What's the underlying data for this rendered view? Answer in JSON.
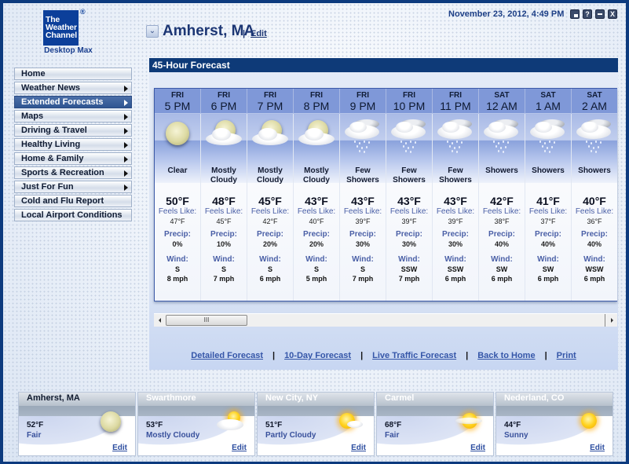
{
  "app": {
    "logo_lines": [
      "The",
      "Weather",
      "Channel"
    ],
    "logo_registered": "®",
    "logo_subtitle": "Desktop Max",
    "datetime": "November 23, 2012, 4:49 PM",
    "window_buttons": [
      {
        "name": "restore",
        "label": ""
      },
      {
        "name": "help",
        "label": "?"
      },
      {
        "name": "minimize",
        "label": ""
      },
      {
        "name": "close",
        "label": "X"
      }
    ]
  },
  "location": {
    "name": "Amherst, MA",
    "separator": "|",
    "edit_label": "Edit"
  },
  "sidebar": {
    "items": [
      {
        "label": "Home",
        "has_submenu": false,
        "active": false
      },
      {
        "label": "Weather News",
        "has_submenu": true,
        "active": false
      },
      {
        "label": "Extended Forecasts",
        "has_submenu": true,
        "active": true
      },
      {
        "label": "Maps",
        "has_submenu": true,
        "active": false
      },
      {
        "label": "Driving & Travel",
        "has_submenu": true,
        "active": false
      },
      {
        "label": "Healthy Living",
        "has_submenu": true,
        "active": false
      },
      {
        "label": "Home & Family",
        "has_submenu": true,
        "active": false
      },
      {
        "label": "Sports & Recreation",
        "has_submenu": true,
        "active": false
      },
      {
        "label": "Just For Fun",
        "has_submenu": true,
        "active": false
      },
      {
        "label": "Cold and Flu Report",
        "has_submenu": false,
        "active": false
      },
      {
        "label": "Local Airport Conditions",
        "has_submenu": false,
        "active": false
      }
    ]
  },
  "forecast": {
    "title": "45-Hour Forecast",
    "feels_like_label": "Feels Like:",
    "precip_label": "Precip:",
    "wind_label": "Wind:",
    "hours": [
      {
        "day": "FRI",
        "time": "5 PM",
        "icon": "moon-clear-icon",
        "condition": "Clear",
        "temp": "50°F",
        "feels_like": "47°F",
        "precip": "0%",
        "wind_dir": "S",
        "wind_speed": "8 mph"
      },
      {
        "day": "FRI",
        "time": "6 PM",
        "icon": "moon-cloudy-icon",
        "condition": "Mostly Cloudy",
        "temp": "48°F",
        "feels_like": "45°F",
        "precip": "10%",
        "wind_dir": "S",
        "wind_speed": "7 mph"
      },
      {
        "day": "FRI",
        "time": "7 PM",
        "icon": "moon-cloudy-icon",
        "condition": "Mostly Cloudy",
        "temp": "45°F",
        "feels_like": "42°F",
        "precip": "20%",
        "wind_dir": "S",
        "wind_speed": "6 mph"
      },
      {
        "day": "FRI",
        "time": "8 PM",
        "icon": "moon-cloudy-icon",
        "condition": "Mostly Cloudy",
        "temp": "43°F",
        "feels_like": "40°F",
        "precip": "20%",
        "wind_dir": "S",
        "wind_speed": "5 mph"
      },
      {
        "day": "FRI",
        "time": "9 PM",
        "icon": "rain-cloud-icon",
        "condition": "Few Showers",
        "temp": "43°F",
        "feels_like": "39°F",
        "precip": "30%",
        "wind_dir": "S",
        "wind_speed": "7 mph"
      },
      {
        "day": "FRI",
        "time": "10 PM",
        "icon": "rain-cloud-icon",
        "condition": "Few Showers",
        "temp": "43°F",
        "feels_like": "39°F",
        "precip": "30%",
        "wind_dir": "SSW",
        "wind_speed": "7 mph"
      },
      {
        "day": "FRI",
        "time": "11 PM",
        "icon": "rain-cloud-icon",
        "condition": "Few Showers",
        "temp": "43°F",
        "feels_like": "39°F",
        "precip": "30%",
        "wind_dir": "SSW",
        "wind_speed": "6 mph"
      },
      {
        "day": "SAT",
        "time": "12 AM",
        "icon": "rain-cloud-icon",
        "condition": "Showers",
        "temp": "42°F",
        "feels_like": "38°F",
        "precip": "40%",
        "wind_dir": "SW",
        "wind_speed": "6 mph"
      },
      {
        "day": "SAT",
        "time": "1 AM",
        "icon": "rain-cloud-icon",
        "condition": "Showers",
        "temp": "41°F",
        "feels_like": "37°F",
        "precip": "40%",
        "wind_dir": "SW",
        "wind_speed": "6 mph"
      },
      {
        "day": "SAT",
        "time": "2 AM",
        "icon": "rain-cloud-icon",
        "condition": "Showers",
        "temp": "40°F",
        "feels_like": "36°F",
        "precip": "40%",
        "wind_dir": "WSW",
        "wind_speed": "6 mph"
      }
    ],
    "scrollbar_grip": "III",
    "links": [
      "Detailed Forecast",
      "10-Day Forecast",
      "Live Traffic Forecast",
      "Back to Home",
      "Print"
    ],
    "link_separator": "|"
  },
  "cities": [
    {
      "name": "Amherst, MA",
      "temp": "52°F",
      "condition": "Fair",
      "icon": "moon-fair-icon",
      "edit_label": "Edit",
      "active": true
    },
    {
      "name": "Swarthmore",
      "temp": "53°F",
      "condition": "Mostly Cloudy",
      "icon": "sun-cloudy-icon",
      "edit_label": "Edit",
      "active": false
    },
    {
      "name": "New City, NY",
      "temp": "51°F",
      "condition": "Partly Cloudy",
      "icon": "sun-partly-cloudy-icon",
      "edit_label": "Edit",
      "active": false
    },
    {
      "name": "Carmel",
      "temp": "68°F",
      "condition": "Fair",
      "icon": "sun-hazy-icon",
      "edit_label": "Edit",
      "active": false
    },
    {
      "name": "Nederland, CO",
      "temp": "44°F",
      "condition": "Sunny",
      "icon": "sun-icon",
      "edit_label": "Edit",
      "active": false
    }
  ]
}
